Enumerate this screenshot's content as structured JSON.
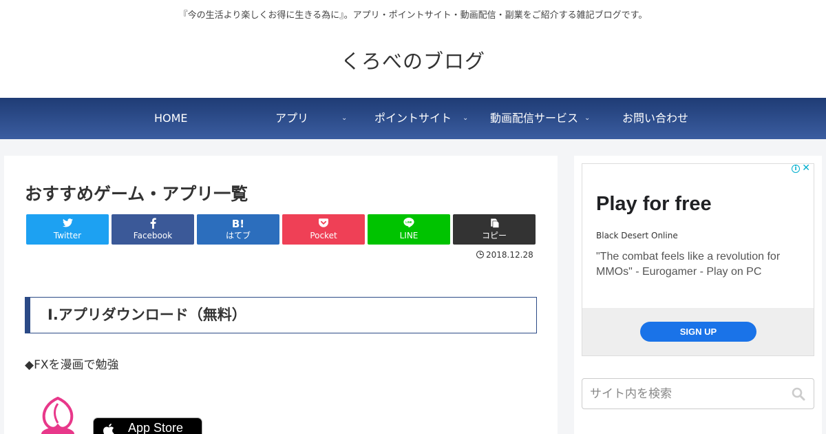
{
  "header": {
    "tagline": "『今の生活より楽しくお得に生きる為に』。アプリ・ポイントサイト・動画配信・副業をご紹介する雑記ブログです。",
    "site_title": "くろべのブログ"
  },
  "nav": {
    "items": [
      {
        "label": "HOME"
      },
      {
        "label": "アプリ",
        "icon": "chevron-down-icon"
      },
      {
        "label": "ポイントサイト",
        "icon": "chevron-down-icon"
      },
      {
        "label": "動画配信サービス",
        "icon": "chevron-down-icon"
      },
      {
        "label": "お問い合わせ"
      }
    ]
  },
  "article": {
    "title": "おすすめゲーム・アプリ一覧",
    "date": "2018.12.28",
    "heading": "Ⅰ.アプリダウンロード（無料）",
    "paragraph": "◆FXを漫画で勉強",
    "app_store_badge": "App Store"
  },
  "share": {
    "buttons": [
      {
        "label": "Twitter",
        "icon": "twitter-icon",
        "color": "#1da1f2"
      },
      {
        "label": "Facebook",
        "icon": "facebook-icon",
        "color": "#3b5998"
      },
      {
        "label": "はてブ",
        "icon_text": "B!",
        "icon": "hatena-icon",
        "color": "#2c6ebd"
      },
      {
        "label": "Pocket",
        "icon": "pocket-icon",
        "color": "#ef4056"
      },
      {
        "label": "LINE",
        "icon": "line-icon",
        "color": "#00c300"
      },
      {
        "label": "コピー",
        "icon": "copy-icon",
        "color": "#333333"
      }
    ]
  },
  "ad": {
    "headline": "Play for free",
    "advertiser": "Black Desert Online",
    "description": "\"The combat feels like a revolution for MMOs\" - Eurogamer - Play on PC",
    "cta": "SIGN UP"
  },
  "search": {
    "placeholder": "サイト内を検索"
  },
  "colors": {
    "nav_top": "#1f3c75",
    "nav_bottom": "#3b5da0",
    "heading_border": "#2b4a86",
    "ad_cta": "#1a73e8",
    "app_icon_pink": "#e8388a"
  }
}
